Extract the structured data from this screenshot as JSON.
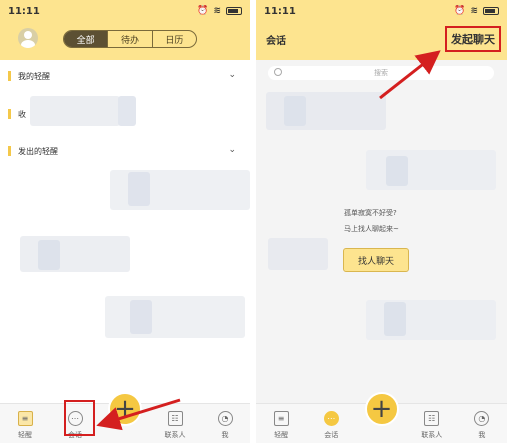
{
  "left": {
    "status": {
      "time": "11:11"
    },
    "header": {
      "tabs": [
        "全部",
        "待办",
        "日历"
      ],
      "active_tab": "全部"
    },
    "sections": [
      {
        "label": "我的轻醒",
        "expanded": true
      },
      {
        "label": "收",
        "expanded": false
      },
      {
        "label": "发出的轻醒",
        "expanded": true
      }
    ],
    "tabbar": {
      "items": [
        "轻醒",
        "会话",
        "",
        "联系人",
        "我"
      ]
    }
  },
  "right": {
    "status": {
      "time": "11:11"
    },
    "header": {
      "title": "会话",
      "action": "发起聊天"
    },
    "search": {
      "placeholder": "搜索"
    },
    "empty": {
      "line1": "孤单寂寞不好受?",
      "line2": "马上找人聊起来~",
      "button": "找人聊天"
    },
    "tabbar": {
      "items": [
        "轻醒",
        "会话",
        "",
        "联系人",
        "我"
      ]
    }
  },
  "colors": {
    "accent": "#fde48f",
    "fab": "#f5c842",
    "annotation": "#d41f1f"
  }
}
